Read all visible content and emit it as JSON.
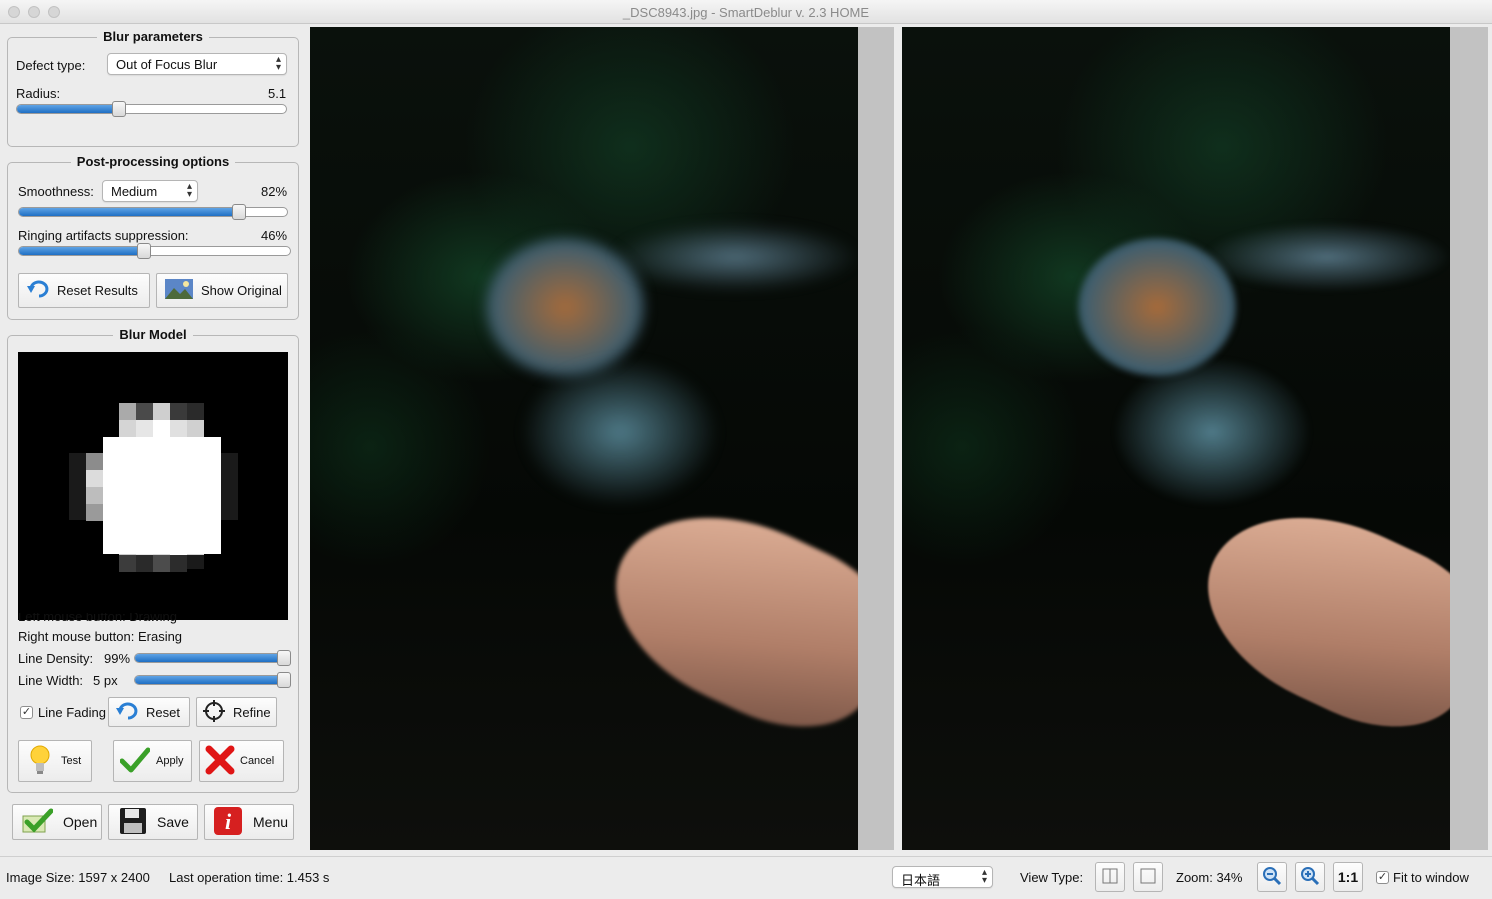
{
  "window": {
    "title": "_DSC8943.jpg - SmartDeblur v. 2.3 HOME"
  },
  "blur_parameters": {
    "title": "Blur parameters",
    "defect_type_label": "Defect type:",
    "defect_type_value": "Out of Focus Blur",
    "radius_label": "Radius:",
    "radius_value": "5.1",
    "radius_fraction": 0.38
  },
  "post_processing": {
    "title": "Post-processing options",
    "smoothness_label": "Smoothness:",
    "smoothness_value": "Medium",
    "smoothness_percent": "82%",
    "smoothness_fraction": 0.82,
    "ringing_label": "Ringing artifacts suppression:",
    "ringing_percent": "46%",
    "ringing_fraction": 0.46,
    "reset_results_label": "Reset Results",
    "show_original_label": "Show Original"
  },
  "blur_model": {
    "title": "Blur Model",
    "left_mouse_text": "Left mouse button:   Drawing",
    "right_mouse_text": "Right mouse button: Erasing",
    "line_density_label": "Line Density:",
    "line_density_value": "99%",
    "line_density_fraction": 0.99,
    "line_width_label": "Line Width:",
    "line_width_value": "5 px",
    "line_width_fraction": 0.99,
    "line_fading_label": "Line Fading",
    "line_fading_checked": true,
    "reset_label": "Reset",
    "refine_label": "Refine",
    "test_label": "Test",
    "apply_label": "Apply",
    "cancel_label": "Cancel"
  },
  "bottom_buttons": {
    "open_label": "Open",
    "save_label": "Save",
    "menu_label": "Menu"
  },
  "status": {
    "image_size_label": "Image Size: 1597 x 2400",
    "last_operation_label": "Last operation time: 1.453 s",
    "language_value": "日本語",
    "view_type_label": "View Type:",
    "zoom_label": "Zoom: 34%",
    "one_to_one_label": "1:1",
    "fit_to_window_label": "Fit to window",
    "fit_to_window_checked": true
  },
  "colors": {
    "slider_fill": "#2f7fd1",
    "apply_check": "#3aa028",
    "cancel_x": "#e01515",
    "menu_red": "#d62020"
  }
}
